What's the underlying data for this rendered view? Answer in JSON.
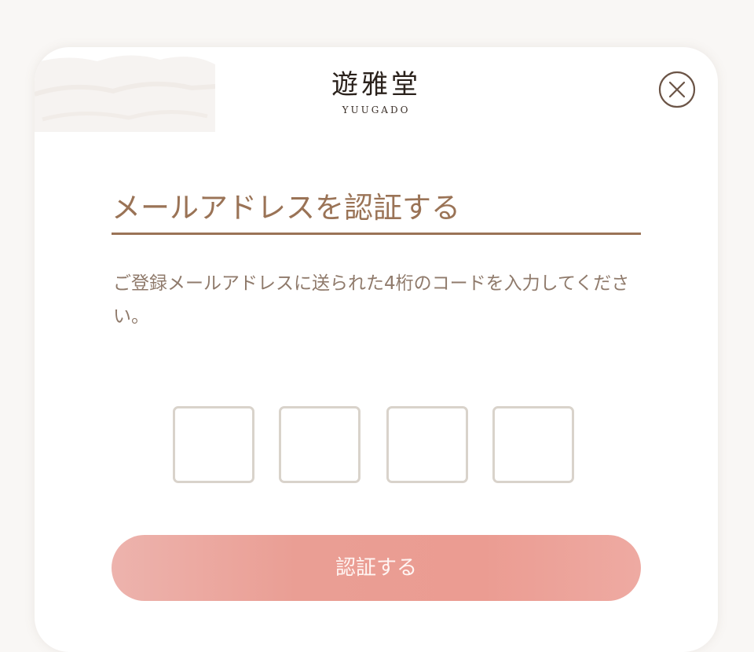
{
  "logo": {
    "kanji": "遊雅堂",
    "roman": "YUUGADO"
  },
  "dialog": {
    "title": "メールアドレスを認証する",
    "description": "ご登録メールアドレスに送られた4桁のコードを入力してください。",
    "code_inputs": [
      {
        "value": ""
      },
      {
        "value": ""
      },
      {
        "value": ""
      },
      {
        "value": ""
      }
    ],
    "submit_label": "認証する"
  },
  "icons": {
    "close": "close-circle-icon"
  },
  "colors": {
    "accent_brown": "#9a7356",
    "text_muted": "#8f7a6b",
    "input_border": "#d9d3cb",
    "button_pink": "#ea9e94",
    "background": "#f9f7f5"
  }
}
